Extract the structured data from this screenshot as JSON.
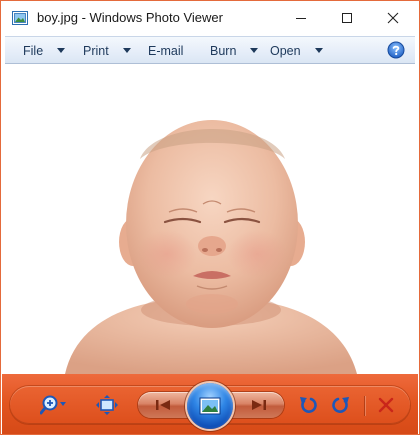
{
  "window": {
    "title": "boy.jpg - Windows Photo Viewer",
    "accent_color": "#e2541f"
  },
  "menu": {
    "items": [
      {
        "label": "File",
        "has_dropdown": true
      },
      {
        "label": "Print",
        "has_dropdown": true
      },
      {
        "label": "E-mail",
        "has_dropdown": false
      },
      {
        "label": "Burn",
        "has_dropdown": true
      },
      {
        "label": "Open",
        "has_dropdown": true
      }
    ],
    "help_icon": "help-icon"
  },
  "viewer": {
    "image_subject": "photo"
  },
  "controls": {
    "icons": [
      "zoom-icon",
      "actual-size-icon",
      "previous-icon",
      "slideshow-icon",
      "next-icon",
      "rotate-counterclockwise-icon",
      "rotate-clockwise-icon",
      "delete-icon"
    ]
  }
}
